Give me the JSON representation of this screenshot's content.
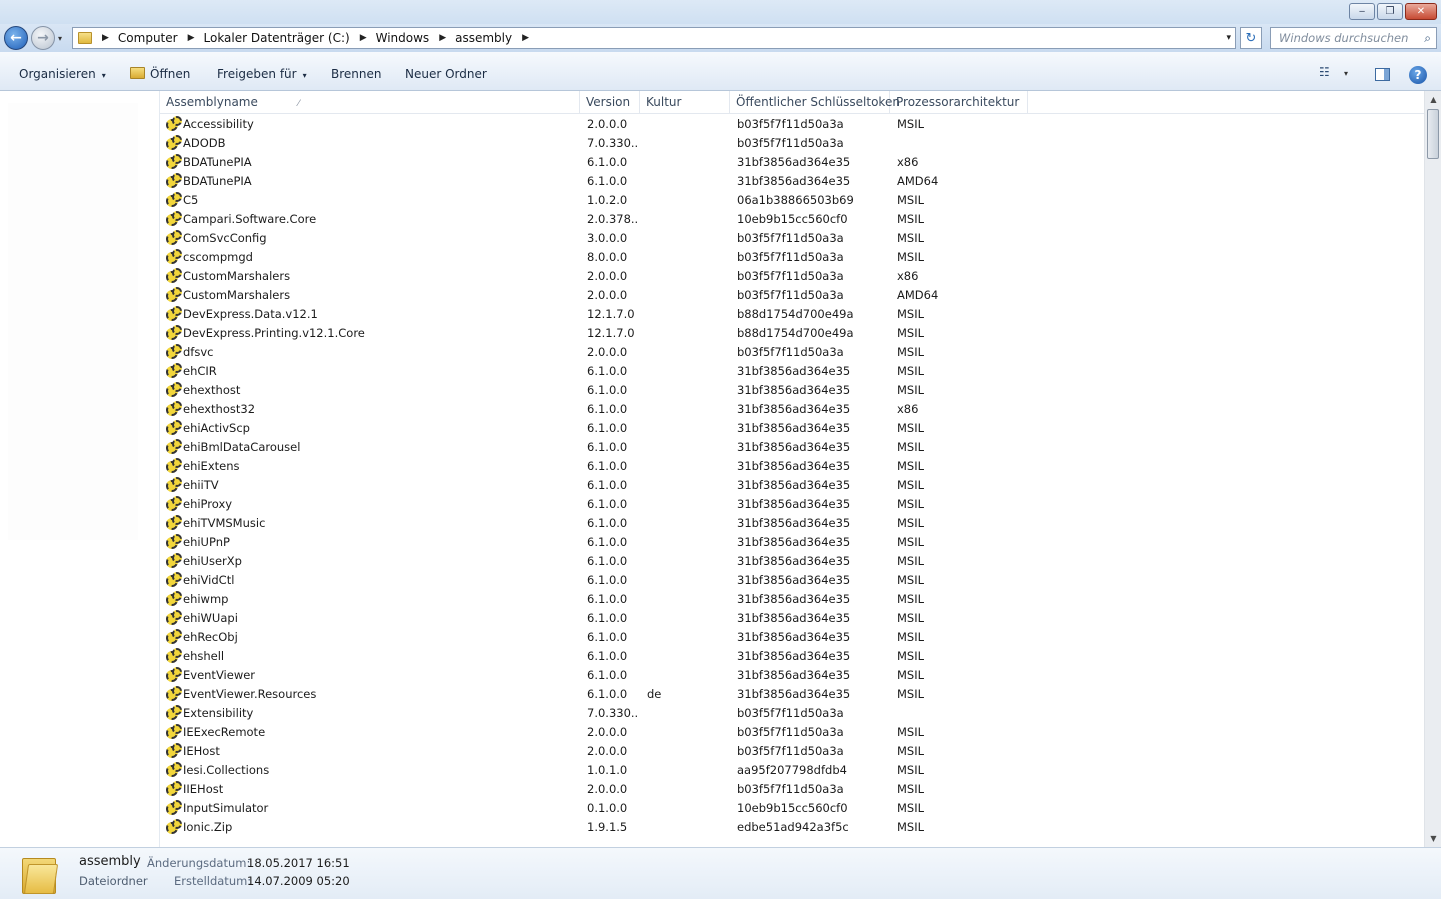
{
  "window": {
    "minimize_glyph": "‒",
    "maximize_glyph": "❐",
    "close_glyph": "✕"
  },
  "nav": {
    "back_glyph": "←",
    "forward_glyph": "→",
    "dropdown_glyph": "▾",
    "breadcrumbs": [
      "Computer",
      "Lokaler Datenträger (C:)",
      "Windows",
      "assembly"
    ],
    "separator": "▶",
    "refresh_glyph": "↻",
    "search_placeholder": "Windows durchsuchen",
    "search_glyph": "⌕"
  },
  "toolbar": {
    "organize": "Organisieren",
    "open": "Öffnen",
    "share": "Freigeben für",
    "burn": "Brennen",
    "new_folder": "Neuer Ordner",
    "dropdown_glyph": "▾",
    "view_glyph": "☷",
    "help_glyph": "?"
  },
  "columns": {
    "name": "Assemblyname",
    "version": "Version",
    "culture": "Kultur",
    "public_key_token": "Öffentlicher Schlüsseltoken",
    "processor_architecture": "Prozessorarchitektur",
    "sort_glyph": "⁄"
  },
  "rows": [
    {
      "name": "Accessibility",
      "version": "2.0.0.0",
      "culture": "",
      "token": "b03f5f7f11d50a3a",
      "arch": "MSIL"
    },
    {
      "name": "ADODB",
      "version": "7.0.330...",
      "culture": "",
      "token": "b03f5f7f11d50a3a",
      "arch": ""
    },
    {
      "name": "BDATunePIA",
      "version": "6.1.0.0",
      "culture": "",
      "token": "31bf3856ad364e35",
      "arch": "x86"
    },
    {
      "name": "BDATunePIA",
      "version": "6.1.0.0",
      "culture": "",
      "token": "31bf3856ad364e35",
      "arch": "AMD64"
    },
    {
      "name": "C5",
      "version": "1.0.2.0",
      "culture": "",
      "token": "06a1b38866503b69",
      "arch": "MSIL"
    },
    {
      "name": "Campari.Software.Core",
      "version": "2.0.378...",
      "culture": "",
      "token": "10eb9b15cc560cf0",
      "arch": "MSIL"
    },
    {
      "name": "ComSvcConfig",
      "version": "3.0.0.0",
      "culture": "",
      "token": "b03f5f7f11d50a3a",
      "arch": "MSIL"
    },
    {
      "name": "cscompmgd",
      "version": "8.0.0.0",
      "culture": "",
      "token": "b03f5f7f11d50a3a",
      "arch": "MSIL"
    },
    {
      "name": "CustomMarshalers",
      "version": "2.0.0.0",
      "culture": "",
      "token": "b03f5f7f11d50a3a",
      "arch": "x86"
    },
    {
      "name": "CustomMarshalers",
      "version": "2.0.0.0",
      "culture": "",
      "token": "b03f5f7f11d50a3a",
      "arch": "AMD64"
    },
    {
      "name": "DevExpress.Data.v12.1",
      "version": "12.1.7.0",
      "culture": "",
      "token": "b88d1754d700e49a",
      "arch": "MSIL"
    },
    {
      "name": "DevExpress.Printing.v12.1.Core",
      "version": "12.1.7.0",
      "culture": "",
      "token": "b88d1754d700e49a",
      "arch": "MSIL"
    },
    {
      "name": "dfsvc",
      "version": "2.0.0.0",
      "culture": "",
      "token": "b03f5f7f11d50a3a",
      "arch": "MSIL"
    },
    {
      "name": "ehCIR",
      "version": "6.1.0.0",
      "culture": "",
      "token": "31bf3856ad364e35",
      "arch": "MSIL"
    },
    {
      "name": "ehexthost",
      "version": "6.1.0.0",
      "culture": "",
      "token": "31bf3856ad364e35",
      "arch": "MSIL"
    },
    {
      "name": "ehexthost32",
      "version": "6.1.0.0",
      "culture": "",
      "token": "31bf3856ad364e35",
      "arch": "x86"
    },
    {
      "name": "ehiActivScp",
      "version": "6.1.0.0",
      "culture": "",
      "token": "31bf3856ad364e35",
      "arch": "MSIL"
    },
    {
      "name": "ehiBmlDataCarousel",
      "version": "6.1.0.0",
      "culture": "",
      "token": "31bf3856ad364e35",
      "arch": "MSIL"
    },
    {
      "name": "ehiExtens",
      "version": "6.1.0.0",
      "culture": "",
      "token": "31bf3856ad364e35",
      "arch": "MSIL"
    },
    {
      "name": "ehiiTV",
      "version": "6.1.0.0",
      "culture": "",
      "token": "31bf3856ad364e35",
      "arch": "MSIL"
    },
    {
      "name": "ehiProxy",
      "version": "6.1.0.0",
      "culture": "",
      "token": "31bf3856ad364e35",
      "arch": "MSIL"
    },
    {
      "name": "ehiTVMSMusic",
      "version": "6.1.0.0",
      "culture": "",
      "token": "31bf3856ad364e35",
      "arch": "MSIL"
    },
    {
      "name": "ehiUPnP",
      "version": "6.1.0.0",
      "culture": "",
      "token": "31bf3856ad364e35",
      "arch": "MSIL"
    },
    {
      "name": "ehiUserXp",
      "version": "6.1.0.0",
      "culture": "",
      "token": "31bf3856ad364e35",
      "arch": "MSIL"
    },
    {
      "name": "ehiVidCtl",
      "version": "6.1.0.0",
      "culture": "",
      "token": "31bf3856ad364e35",
      "arch": "MSIL"
    },
    {
      "name": "ehiwmp",
      "version": "6.1.0.0",
      "culture": "",
      "token": "31bf3856ad364e35",
      "arch": "MSIL"
    },
    {
      "name": "ehiWUapi",
      "version": "6.1.0.0",
      "culture": "",
      "token": "31bf3856ad364e35",
      "arch": "MSIL"
    },
    {
      "name": "ehRecObj",
      "version": "6.1.0.0",
      "culture": "",
      "token": "31bf3856ad364e35",
      "arch": "MSIL"
    },
    {
      "name": "ehshell",
      "version": "6.1.0.0",
      "culture": "",
      "token": "31bf3856ad364e35",
      "arch": "MSIL"
    },
    {
      "name": "EventViewer",
      "version": "6.1.0.0",
      "culture": "",
      "token": "31bf3856ad364e35",
      "arch": "MSIL"
    },
    {
      "name": "EventViewer.Resources",
      "version": "6.1.0.0",
      "culture": "de",
      "token": "31bf3856ad364e35",
      "arch": "MSIL"
    },
    {
      "name": "Extensibility",
      "version": "7.0.330...",
      "culture": "",
      "token": "b03f5f7f11d50a3a",
      "arch": ""
    },
    {
      "name": "IEExecRemote",
      "version": "2.0.0.0",
      "culture": "",
      "token": "b03f5f7f11d50a3a",
      "arch": "MSIL"
    },
    {
      "name": "IEHost",
      "version": "2.0.0.0",
      "culture": "",
      "token": "b03f5f7f11d50a3a",
      "arch": "MSIL"
    },
    {
      "name": "Iesi.Collections",
      "version": "1.0.1.0",
      "culture": "",
      "token": "aa95f207798dfdb4",
      "arch": "MSIL"
    },
    {
      "name": "IIEHost",
      "version": "2.0.0.0",
      "culture": "",
      "token": "b03f5f7f11d50a3a",
      "arch": "MSIL"
    },
    {
      "name": "InputSimulator",
      "version": "0.1.0.0",
      "culture": "",
      "token": "10eb9b15cc560cf0",
      "arch": "MSIL"
    },
    {
      "name": "Ionic.Zip",
      "version": "1.9.1.5",
      "culture": "",
      "token": "edbe51ad942a3f5c",
      "arch": "MSIL"
    }
  ],
  "scrollbar": {
    "up_glyph": "▲",
    "down_glyph": "▼"
  },
  "details": {
    "name": "assembly",
    "type": "Dateiordner",
    "modified_label": "Änderungsdatum:",
    "modified_value": "18.05.2017 16:51",
    "created_label": "Erstelldatum:",
    "created_value": "14.07.2009 05:20"
  }
}
